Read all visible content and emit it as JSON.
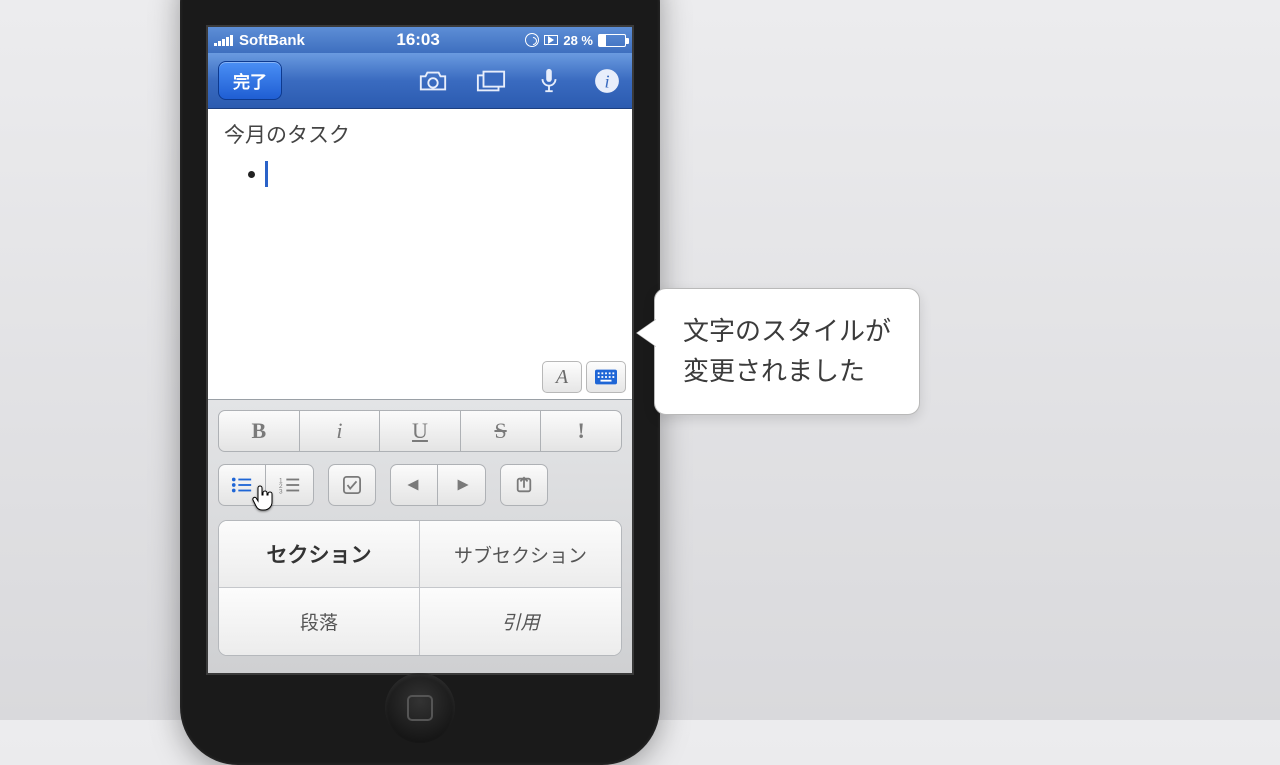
{
  "status": {
    "carrier": "SoftBank",
    "time": "16:03",
    "battery_pct": "28 %"
  },
  "nav": {
    "done_label": "完了"
  },
  "editor": {
    "title": "今月のタスク"
  },
  "format": {
    "bold": "B",
    "italic": "i",
    "underline": "U",
    "strike": "S",
    "highlight": "!"
  },
  "sections": {
    "section": "セクション",
    "subsection": "サブセクション",
    "paragraph": "段落",
    "quote": "引用"
  },
  "minitab": {
    "text": "A"
  },
  "callout": {
    "line1": "文字のスタイルが",
    "line2": "変更されました"
  }
}
